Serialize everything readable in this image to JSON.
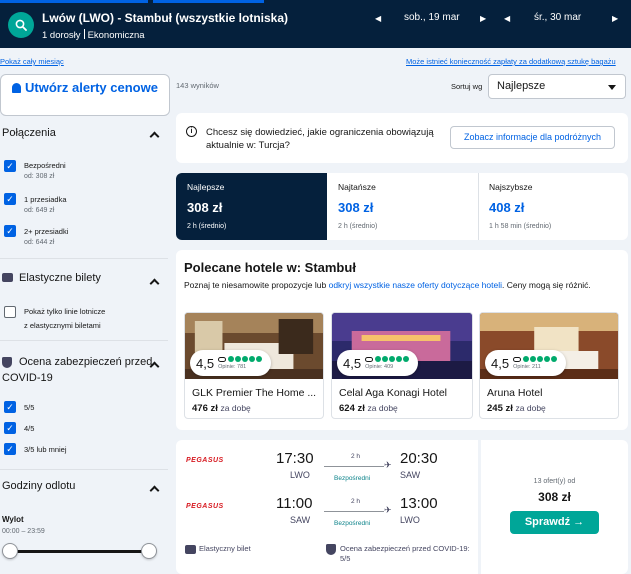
{
  "header": {
    "route": "Lwów (LWO) - Stambuł (wszystkie lotniska)",
    "passengers": "1 dorosły",
    "cabin": "Ekonomiczna",
    "depart_date": "sob., 19 mar",
    "return_date": "śr., 30 mar"
  },
  "links": {
    "whole_month": "Pokaż cały miesiąc",
    "baggage_notice": "Może istnieć konieczność zapłaty za dodatkową sztukę bagażu"
  },
  "sidebar": {
    "alert_button": "Utwórz alerty cenowe",
    "connections_title": "Połączenia",
    "connections": [
      {
        "label": "Bezpośredni",
        "sub": "od: 308 zł",
        "checked": true
      },
      {
        "label": "1 przesiadka",
        "sub": "od: 649 zł",
        "checked": true
      },
      {
        "label": "2+ przesiadki",
        "sub": "od: 644 zł",
        "checked": true
      }
    ],
    "flex_title": "Elastyczne bilety",
    "flex_option_line1": "Pokaż tylko linie lotnicze",
    "flex_option_line2": "z elastycznymi biletami",
    "safety_title_line1": "Ocena zabezpieczeń przed",
    "safety_title_line2": "COVID-19",
    "safety": [
      {
        "label": "5/5",
        "checked": true
      },
      {
        "label": "4/5",
        "checked": true
      },
      {
        "label": "3/5 lub mniej",
        "checked": true
      }
    ],
    "departure_title": "Godziny odlotu",
    "departure_label": "Wylot",
    "departure_range": "00:00 – 23:59"
  },
  "main": {
    "results_count": "143 wyników",
    "sort_label": "Sortuj wg",
    "sort_value": "Najlepsze",
    "info_text": "Chcesz się dowiedzieć, jakie ograniczenia obowiązują aktualnie w: Turcja?",
    "info_button": "Zobacz informacje dla podróżnych",
    "tabs": [
      {
        "name": "Najlepsze",
        "price": "308 zł",
        "sub": "2 h (średnio)"
      },
      {
        "name": "Najtańsze",
        "price": "308 zł",
        "sub": "2 h (średnio)"
      },
      {
        "name": "Najszybsze",
        "price": "408 zł",
        "sub": "1 h 58 min (średnio)"
      }
    ],
    "hotels_title": "Polecane hotele w: Stambuł",
    "hotels_desc_1": "Poznaj te niesamowite propozycje lub ",
    "hotels_desc_link": "odkryj wszystkie nasze oferty dotyczące hoteli",
    "hotels_desc_2": ". Ceny mogą się różnić.",
    "hotels": [
      {
        "name": "GLK Premier The Home ...",
        "rating": "4,5",
        "reviews": "Opinie: 781",
        "price": "476 zł",
        "per": "za dobę"
      },
      {
        "name": "Celal Aga Konagi Hotel",
        "rating": "4,5",
        "reviews": "Opinie: 409",
        "price": "624 zł",
        "per": "za dobę"
      },
      {
        "name": "Aruna Hotel",
        "rating": "4,5",
        "reviews": "Opinie: 211",
        "price": "245 zł",
        "per": "za dobę"
      }
    ],
    "flight": {
      "airline": "PEGASUS",
      "outbound": {
        "dep_time": "17:30",
        "dep_code": "LWO",
        "arr_time": "20:30",
        "arr_code": "SAW",
        "duration": "2 h",
        "stops": "Bezpośredni"
      },
      "inbound": {
        "dep_time": "11:00",
        "dep_code": "SAW",
        "arr_time": "13:00",
        "arr_code": "LWO",
        "duration": "2 h",
        "stops": "Bezpośredni"
      },
      "feature_flex": "Elastyczny bilet",
      "feature_safety": "Ocena zabezpieczeń przed COVID-19: 5/5",
      "offers": "13 ofert(y) od",
      "price": "308 zł",
      "select_button": "Sprawdź →"
    }
  }
}
